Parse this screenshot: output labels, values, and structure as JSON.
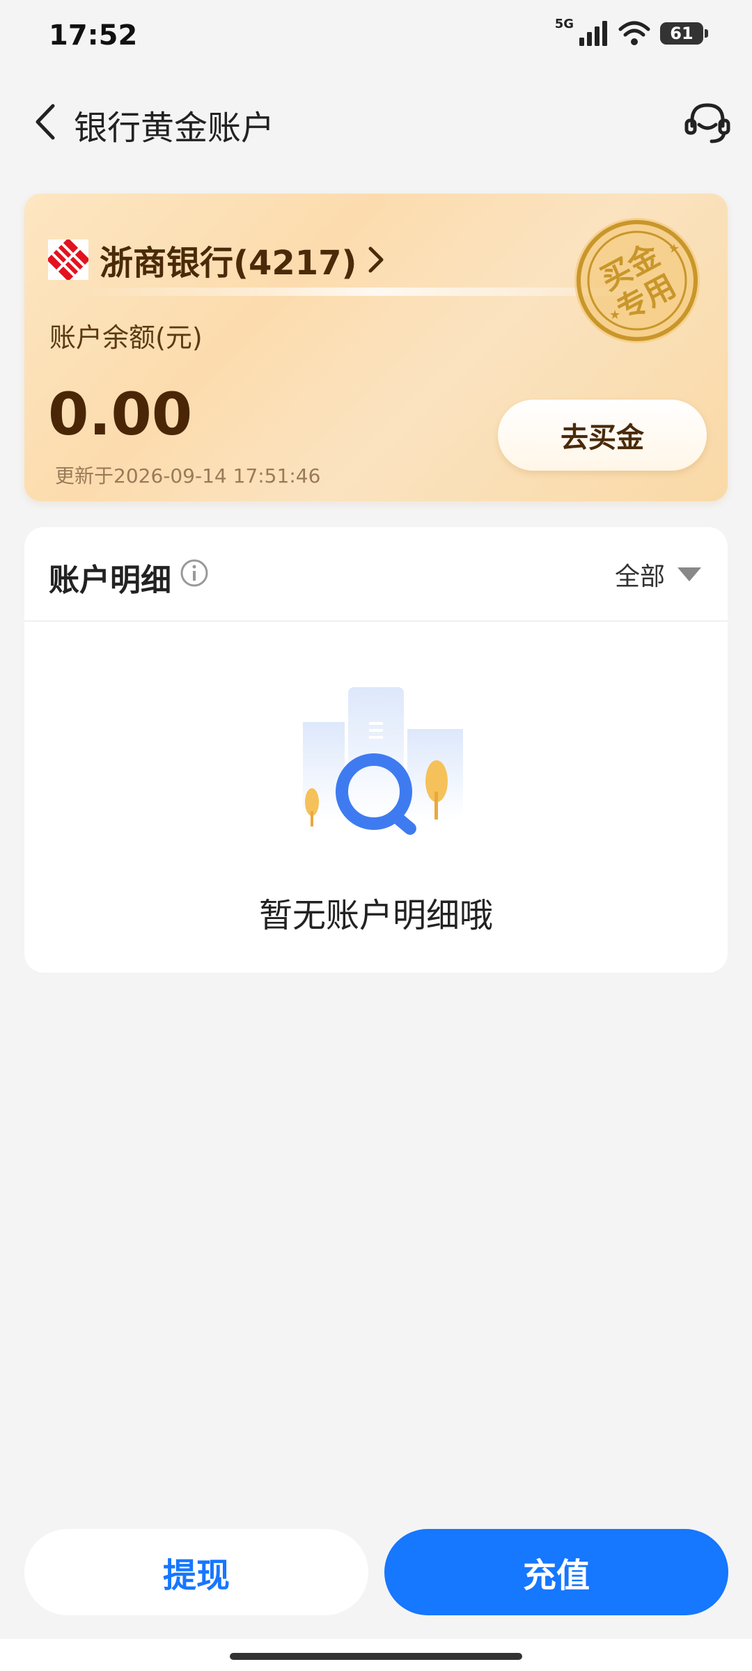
{
  "status_bar": {
    "time": "17:52",
    "network": "5G",
    "battery": "61"
  },
  "header": {
    "title": "银行黄金账户"
  },
  "gold_card": {
    "bank_name": "浙商银行(4217)",
    "balance_label": "账户余额(元)",
    "balance": "0.00",
    "updated": "更新于2026-09-14 17:51:46",
    "buy_button": "去买金",
    "stamp_text": "买金专用"
  },
  "detail": {
    "title": "账户明细",
    "filter": "全部",
    "empty_text": "暂无账户明细哦"
  },
  "actions": {
    "withdraw": "提现",
    "recharge": "充值"
  },
  "colors": {
    "accent": "#1677ff",
    "gold_text": "#4a2606",
    "stamp": "#c8962a"
  }
}
